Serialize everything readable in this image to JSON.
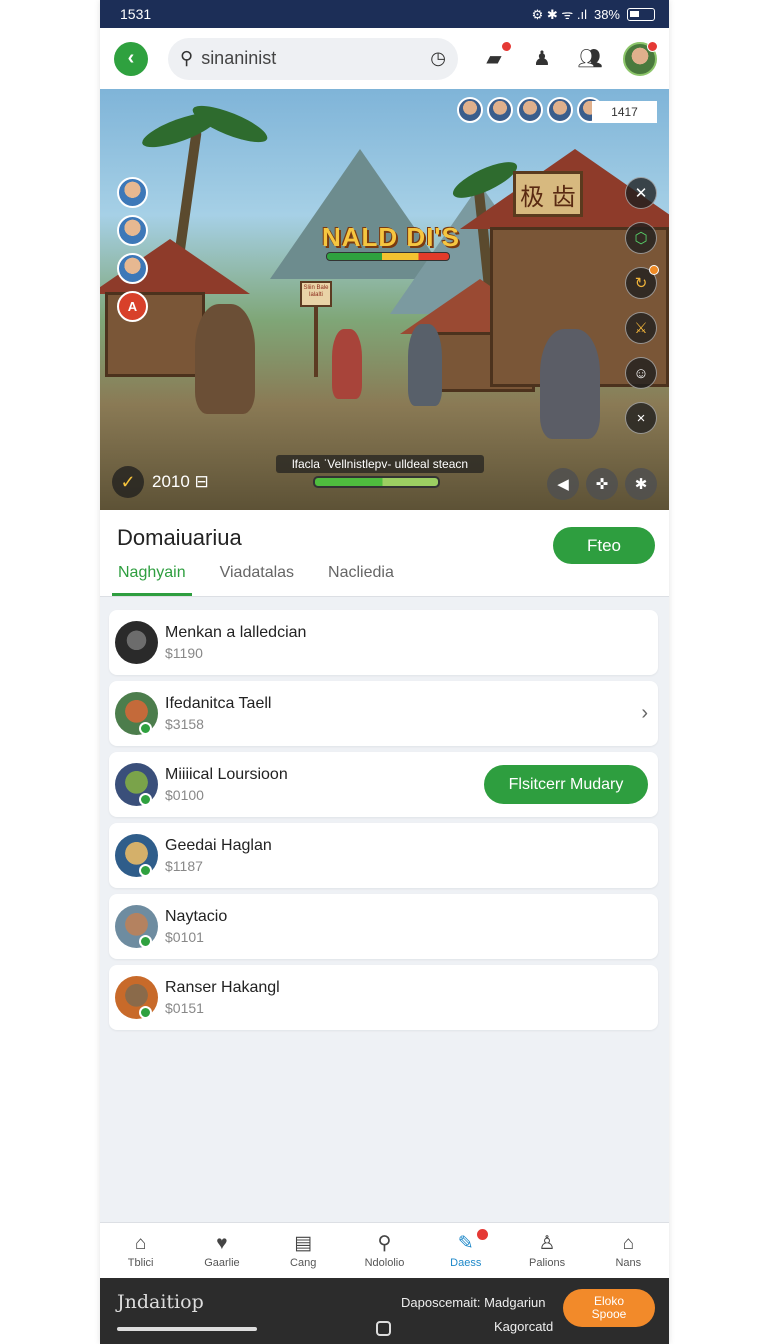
{
  "status_bar": {
    "time": "1531",
    "icons": "⚙ ✱ ᯤ .ıl",
    "battery": "38%"
  },
  "app_bar": {
    "search_value": "sinaninist",
    "notifications_badge": true,
    "profile_badge": true
  },
  "hero": {
    "game_title": "NALD DI'S",
    "counter": "1417",
    "score": "2010 ⊟",
    "caption": "lfacla ˈVellnistlepv- ulldeal steacn",
    "sign_text": "Sliin Bale lalalti",
    "hut_sign": "极 齿",
    "left_badge": "A"
  },
  "content": {
    "title": "Domaiuariua",
    "free_button": "Fteo",
    "tabs": [
      "Naghyain",
      "Viadatalas",
      "Nacliedia"
    ],
    "active_tab": 0
  },
  "items": [
    {
      "name": "Menkan a lalledcian",
      "price": "$1190"
    },
    {
      "name": "Ifedanitca Taell",
      "price": "$3158"
    },
    {
      "name": "Miiiical Loursioon",
      "price": "$0100",
      "button": "Flsitcerr Mudary"
    },
    {
      "name": "Geedai Haglan",
      "price": "$1187"
    },
    {
      "name": "Naytacio",
      "price": "$0101"
    },
    {
      "name": "Ranser Hakangl",
      "price": "$0151"
    }
  ],
  "bottom_nav": [
    {
      "label": "Tblici",
      "icon": "home-icon"
    },
    {
      "label": "Gaarlie",
      "icon": "heart-icon"
    },
    {
      "label": "Cang",
      "icon": "note-icon"
    },
    {
      "label": "Ndololio",
      "icon": "search-icon"
    },
    {
      "label": "Daess",
      "icon": "edit-icon",
      "active": true,
      "badge": true
    },
    {
      "label": "Palions",
      "icon": "person-icon"
    },
    {
      "label": "Nans",
      "icon": "home-icon"
    }
  ],
  "bottom_bar": {
    "brand": "Jndaitiop",
    "info_line1": "Daposcemait: Madgariun",
    "info_line2": "Kagorcatd",
    "button_line1": "Eloko",
    "button_line2": "Spooe"
  },
  "colors": {
    "accent_green": "#2e9e3f",
    "status_bar": "#1c2e57",
    "active_nav": "#1e88c9",
    "orange": "#f28a2a"
  }
}
